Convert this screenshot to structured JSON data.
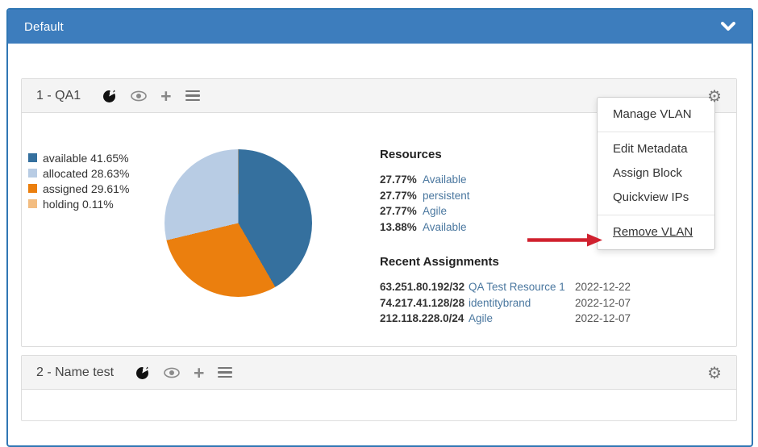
{
  "accordion": {
    "title": "Default",
    "chevron_icon": "chevron-down-icon"
  },
  "colors": {
    "accordion_header_bg": "#3d7dbd",
    "accordion_border": "#3077b4",
    "panel_header_bg": "#f4f4f4",
    "link": "#4a779f",
    "arrow_red": "#d0212f"
  },
  "panel1": {
    "title": "1 - QA1",
    "toolbar_icons": [
      "pie-chart-icon",
      "eye-icon",
      "plus-icon",
      "list-icon",
      "gear-icon"
    ],
    "resources": {
      "heading": "Resources",
      "rows": [
        {
          "pct": "27.77%",
          "label": "Available"
        },
        {
          "pct": "27.77%",
          "label": "persistent"
        },
        {
          "pct": "27.77%",
          "label": "Agile"
        },
        {
          "pct": "13.88%",
          "label": "Available"
        }
      ]
    },
    "recent": {
      "heading": "Recent Assignments",
      "rows": [
        {
          "cidr": "63.251.80.192/32",
          "name": "QA Test Resource 1",
          "date": "2022-12-22"
        },
        {
          "cidr": "74.217.41.128/28",
          "name": "identitybrand",
          "date": "2022-12-07"
        },
        {
          "cidr": "212.118.228.0/24",
          "name": "Agile",
          "date": "2022-12-07"
        }
      ]
    }
  },
  "panel2": {
    "title": "2 - Name test",
    "toolbar_icons": [
      "pie-chart-icon",
      "eye-icon",
      "plus-icon",
      "list-icon",
      "gear-icon"
    ]
  },
  "menu": {
    "items": [
      "Manage VLAN",
      "Edit Metadata",
      "Assign Block",
      "Quickview IPs",
      "Remove VLAN"
    ],
    "highlighted_item": "Remove VLAN"
  },
  "chart_data": {
    "type": "pie",
    "title": "",
    "legend_position": "left",
    "slices": [
      {
        "label": "available",
        "value": 41.65,
        "color": "#35709e"
      },
      {
        "label": "allocated",
        "value": 28.63,
        "color": "#b8cce4"
      },
      {
        "label": "assigned",
        "value": 29.61,
        "color": "#eb7f0e"
      },
      {
        "label": "holding",
        "value": 0.11,
        "color": "#f3bd81"
      }
    ],
    "clockwise_order_from_top": [
      0,
      2,
      1,
      3
    ]
  }
}
